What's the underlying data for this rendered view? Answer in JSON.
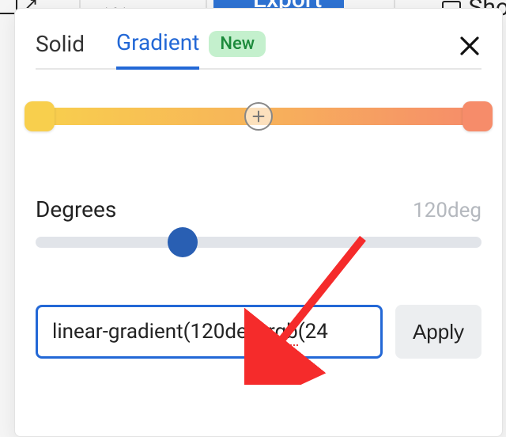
{
  "toolbar": {
    "export_label": "Export",
    "right_partial": "Sho"
  },
  "tabs": {
    "solid": "Solid",
    "gradient": "Gradient",
    "badge": "New"
  },
  "gradient": {
    "stop1_color": "#f8cf4d",
    "stop2_color": "#f68c6a",
    "track_css": "linear-gradient(90deg, #f8cf4d 0%, #f7b35a 50%, #f68c6a 100%)"
  },
  "degrees": {
    "label": "Degrees",
    "value_display": "120deg",
    "value": 120,
    "min": 0,
    "max": 360,
    "thumb_percent": 33
  },
  "input": {
    "value_prefix": "linear-gradient(120deg, ",
    "value_spell": "rgb",
    "value_suffix": "(24",
    "full_value": "linear-gradient(120deg, rgb(24"
  },
  "apply_label": "Apply"
}
